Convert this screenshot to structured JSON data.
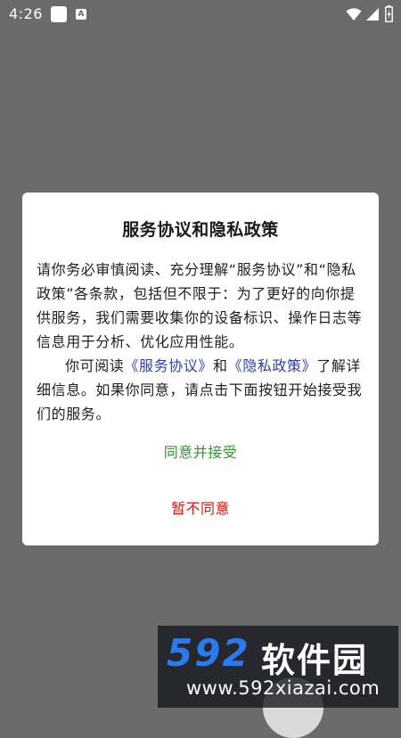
{
  "status_bar": {
    "time": "4:26",
    "notification_icon_letter": "A",
    "icons": [
      "square-notification-icon",
      "a-notification-icon",
      "wifi-icon",
      "signal-icon",
      "battery-icon"
    ]
  },
  "dialog": {
    "title": "服务协议和隐私政策",
    "paragraph1": "请你务必审慎阅读、充分理解“服务协议”和“隐私政策”各条款，包括但不限于：为了更好的向你提供服务，我们需要收集你的设备标识、操作日志等信息用于分析、优化应用性能。",
    "p2_prefix": "你可阅读",
    "service_link": "《服务协议》",
    "p2_and": "和",
    "privacy_link": "《隐私政策》",
    "p2_suffix": "了解详细信息。如果你同意，请点击下面按钮开始接受我们的服务。",
    "agree_label": "同意并接受",
    "disagree_label": "暂不同意"
  },
  "watermark": {
    "logo": "592",
    "name": "软件园",
    "url": "www.592xiazai.com"
  },
  "colors": {
    "overlay": "#6b6b6b",
    "link": "#2f3fb0",
    "agree": "#2e9a2e",
    "disagree": "#d01a1a",
    "watermark_logo": "#2a7bf0"
  }
}
